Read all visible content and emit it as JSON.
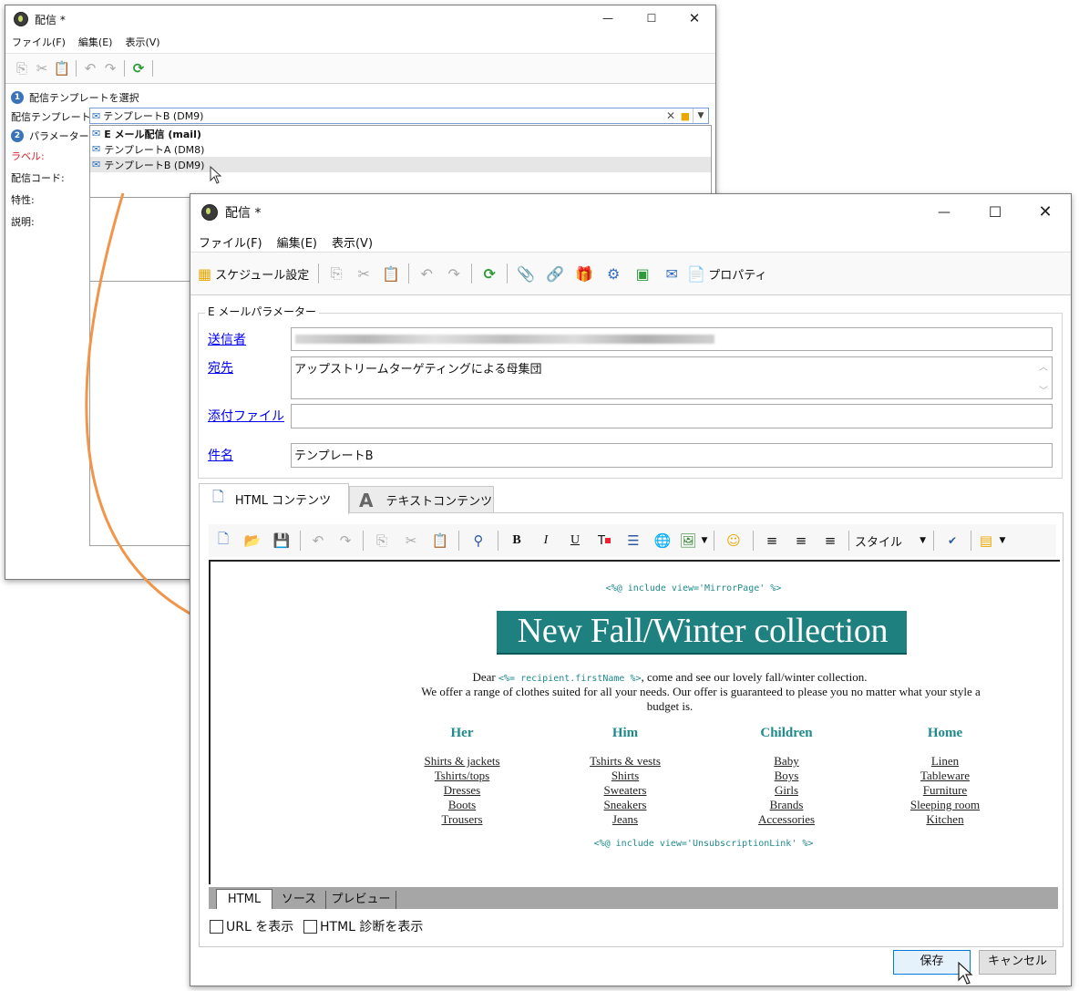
{
  "back_window": {
    "title": "配信 *",
    "menu": [
      "ファイル(F)",
      "編集(E)",
      "表示(V)"
    ],
    "step1": "配信テンプレートを選択",
    "template_label": "配信テンプレート:",
    "template_value": "テンプレートB (DM9)",
    "step2": "パラメーターを",
    "label_label": "ラベル:",
    "code_label": "配信コード:",
    "nature_label": "特性:",
    "desc_label": "説明:",
    "dropdown_items": [
      "E メール配信 (mail)",
      "テンプレートA (DM8)",
      "テンプレートB (DM9)"
    ],
    "step1_num": "1",
    "step2_num": "2"
  },
  "front_window": {
    "title": "配信 *",
    "menu": [
      "ファイル(F)",
      "編集(E)",
      "表示(V)"
    ],
    "schedule_label": "スケジュール設定",
    "properties_label": "プロパティ",
    "group_title": "E メールパラメーター",
    "sender_label": "送信者",
    "to_label": "宛先",
    "to_value": "アップストリームターゲティングによる母集団",
    "attach_label": "添付ファイル",
    "subject_label": "件名",
    "subject_value": "テンプレートB",
    "tab_html": "HTML コンテンツ",
    "tab_text": "テキストコンテンツ",
    "style_label": "スタイル",
    "bottom_tabs": [
      "HTML",
      "ソース",
      "プレビュー"
    ],
    "chk_url": "URL を表示",
    "chk_diag": "HTML 診断を表示",
    "save_label": "保存",
    "cancel_label": "キャンセル"
  },
  "email": {
    "mirror": "<%@ include view='MirrorPage' %>",
    "banner": "New Fall/Winter collection",
    "dear": "Dear",
    "recipient_tag": "<%= recipient.firstName %>",
    "intro_rest": ", come and see our lovely fall/winter collection.",
    "line2": "We offer a range of clothes suited for all your needs. Our offer is guaranteed to please you no matter what your style a",
    "line3": "budget is.",
    "columns": [
      {
        "title": "Her",
        "items": [
          "Shirts & jackets",
          "Tshirts/tops",
          "Dresses",
          "Boots",
          "Trousers"
        ]
      },
      {
        "title": "Him",
        "items": [
          "Tshirts & vests",
          "Shirts",
          "Sweaters",
          "Sneakers",
          "Jeans"
        ]
      },
      {
        "title": "Children",
        "items": [
          "Baby",
          "Boys",
          "Girls",
          "Brands",
          "Accessories"
        ]
      },
      {
        "title": "Home",
        "items": [
          "Linen",
          "Tableware",
          "Furniture",
          "Sleeping room",
          "Kitchen"
        ]
      }
    ],
    "unsub": "<%@ include view='UnsubscriptionLink' %>"
  },
  "colors": {
    "teal": "#1f8a8a",
    "arrow": "#f0954a",
    "link": "#0000ee",
    "label_red": "#e0202a"
  }
}
